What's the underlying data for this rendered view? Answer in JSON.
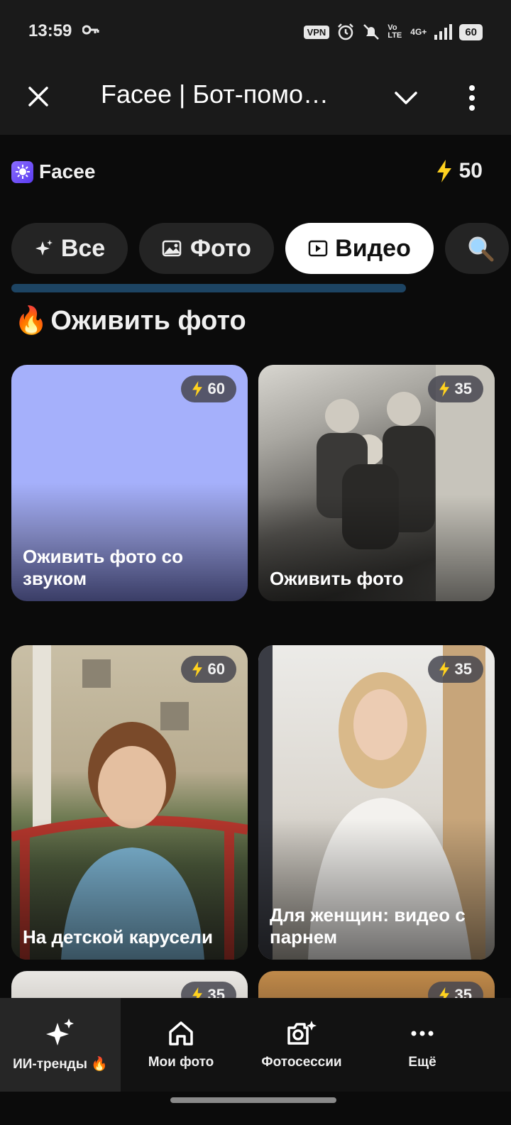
{
  "status": {
    "time": "13:59",
    "vpn": "VPN",
    "volte": "Vo LTE",
    "network": "4G+",
    "battery": "60"
  },
  "header": {
    "title": "Facee | Бот-помо…"
  },
  "app": {
    "name": "Facee",
    "balance": "50"
  },
  "tabs": [
    {
      "label": "Все",
      "icon": "sparkle-icon",
      "active": false
    },
    {
      "label": "Фото",
      "icon": "image-icon",
      "active": false
    },
    {
      "label": "Видео",
      "icon": "video-icon",
      "active": true
    },
    {
      "label": "",
      "icon": "search-icon",
      "active": false
    }
  ],
  "section": {
    "title": "Оживить фото",
    "emoji": "🔥"
  },
  "cards": [
    {
      "label": "Оживить фото со звуком",
      "cost": "60"
    },
    {
      "label": "Оживить фото",
      "cost": "35"
    },
    {
      "label": "На детской карусели",
      "cost": "60"
    },
    {
      "label": "Для женщин: видео с парнем",
      "cost": "35"
    },
    {
      "label": "",
      "cost": "35"
    },
    {
      "label": "",
      "cost": "35"
    }
  ],
  "nav": [
    {
      "label": "ИИ-тренды 🔥",
      "icon": "sparkles-icon",
      "active": true
    },
    {
      "label": "Мои фото",
      "icon": "home-icon",
      "active": false
    },
    {
      "label": "Фотосессии",
      "icon": "camera-sparkle-icon",
      "active": false
    },
    {
      "label": "Ещё",
      "icon": "more-horizontal-icon",
      "active": false
    }
  ],
  "colors": {
    "accent": "#FFD21F",
    "progress": "#1d4463",
    "brand": "#6a4cf5"
  }
}
